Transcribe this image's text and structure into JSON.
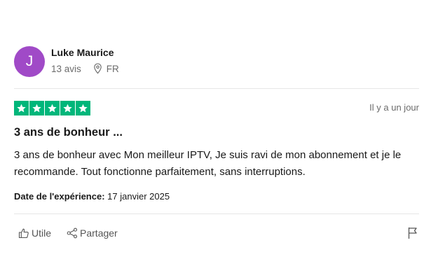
{
  "reviewer": {
    "initial": "J",
    "avatar_color": "#a04ac7",
    "name": "Luke Maurice",
    "review_count": "13 avis",
    "country": "FR"
  },
  "review": {
    "rating": 5,
    "star_color": "#00b67a",
    "date_posted": "Il y a un jour",
    "title": "3 ans de bonheur ...",
    "body": "3 ans de bonheur avec Mon meilleur IPTV, Je suis ravi de mon abonnement et je le recommande. Tout fonctionne parfaitement, sans interruptions.",
    "experience_label": "Date de l'expérience:",
    "experience_date": "17 janvier 2025"
  },
  "actions": {
    "useful_label": "Utile",
    "share_label": "Partager",
    "flag_icon": "flag-icon"
  }
}
